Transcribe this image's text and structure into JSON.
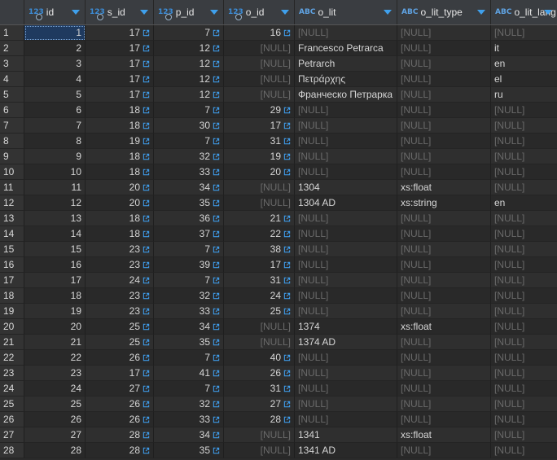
{
  "columns": [
    {
      "name": "id",
      "type": "123",
      "kind": "num",
      "key": true
    },
    {
      "name": "s_id",
      "type": "123",
      "kind": "num",
      "key": true
    },
    {
      "name": "p_id",
      "type": "123",
      "kind": "num",
      "key": true
    },
    {
      "name": "o_id",
      "type": "123",
      "kind": "num",
      "key": true
    },
    {
      "name": "o_lit",
      "type": "ABC",
      "kind": "str",
      "key": false
    },
    {
      "name": "o_lit_type",
      "type": "ABC",
      "kind": "str",
      "key": false
    },
    {
      "name": "o_lit_lang",
      "type": "ABC",
      "kind": "str",
      "key": false
    }
  ],
  "null_label": "[NULL]",
  "rows": [
    [
      "1",
      "17",
      "7",
      "16",
      null,
      null,
      null
    ],
    [
      "2",
      "17",
      "12",
      null,
      "Francesco Petrarca",
      null,
      "it"
    ],
    [
      "3",
      "17",
      "12",
      null,
      "Petrarch",
      null,
      "en"
    ],
    [
      "4",
      "17",
      "12",
      null,
      "Πετράρχης",
      null,
      "el"
    ],
    [
      "5",
      "17",
      "12",
      null,
      "Франческо Петрарка",
      null,
      "ru"
    ],
    [
      "6",
      "18",
      "7",
      "29",
      null,
      null,
      null
    ],
    [
      "7",
      "18",
      "30",
      "17",
      null,
      null,
      null
    ],
    [
      "8",
      "19",
      "7",
      "31",
      null,
      null,
      null
    ],
    [
      "9",
      "18",
      "32",
      "19",
      null,
      null,
      null
    ],
    [
      "10",
      "18",
      "33",
      "20",
      null,
      null,
      null
    ],
    [
      "11",
      "20",
      "34",
      null,
      "1304",
      "xs:float",
      null
    ],
    [
      "12",
      "20",
      "35",
      null,
      "1304 AD",
      "xs:string",
      "en"
    ],
    [
      "13",
      "18",
      "36",
      "21",
      null,
      null,
      null
    ],
    [
      "14",
      "18",
      "37",
      "22",
      null,
      null,
      null
    ],
    [
      "15",
      "23",
      "7",
      "38",
      null,
      null,
      null
    ],
    [
      "16",
      "23",
      "39",
      "17",
      null,
      null,
      null
    ],
    [
      "17",
      "24",
      "7",
      "31",
      null,
      null,
      null
    ],
    [
      "18",
      "23",
      "32",
      "24",
      null,
      null,
      null
    ],
    [
      "19",
      "23",
      "33",
      "25",
      null,
      null,
      null
    ],
    [
      "20",
      "25",
      "34",
      null,
      "1374",
      "xs:float",
      null
    ],
    [
      "21",
      "25",
      "35",
      null,
      "1374 AD",
      null,
      null
    ],
    [
      "22",
      "26",
      "7",
      "40",
      null,
      null,
      null
    ],
    [
      "23",
      "17",
      "41",
      "26",
      null,
      null,
      null
    ],
    [
      "24",
      "27",
      "7",
      "31",
      null,
      null,
      null
    ],
    [
      "25",
      "26",
      "32",
      "27",
      null,
      null,
      null
    ],
    [
      "26",
      "26",
      "33",
      "28",
      null,
      null,
      null
    ],
    [
      "27",
      "28",
      "34",
      null,
      "1341",
      "xs:float",
      null
    ],
    [
      "28",
      "28",
      "35",
      null,
      "1341 AD",
      null,
      null
    ]
  ]
}
